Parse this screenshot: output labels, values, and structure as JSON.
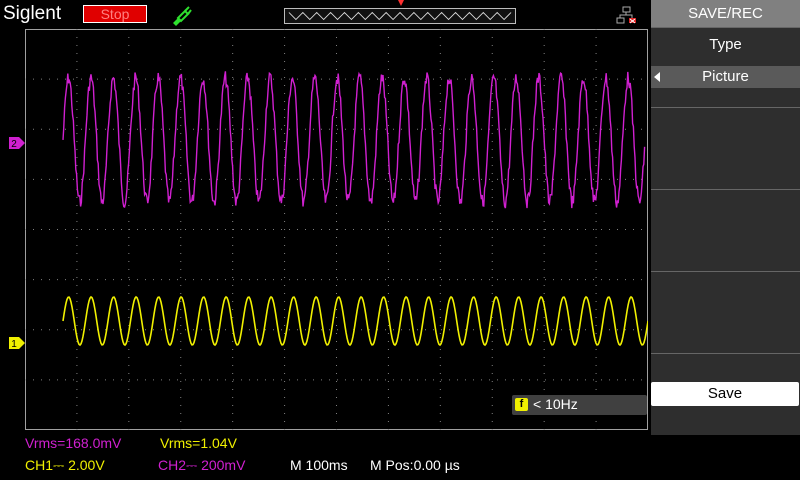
{
  "top": {
    "brand": "Siglent",
    "run_state": "Stop",
    "run_state_color": "#e00000"
  },
  "measurements": {
    "ch2_vrms": "Vrms=168.0mV",
    "ch1_vrms": "Vrms=1.04V"
  },
  "status": {
    "ch1_scale": "CH1⎓ 2.00V",
    "ch2_scale": "CH2⎓ 200mV",
    "timebase": "M 100ms",
    "mpos": "M Pos:0.00 µs"
  },
  "freq": {
    "badge": "f",
    "text": "< 10Hz"
  },
  "markers": {
    "ch1": "1",
    "ch2": "2"
  },
  "menu": {
    "title": "SAVE/REC",
    "type_label": "Type",
    "type_value": "Picture",
    "save_button": "Save"
  },
  "colors": {
    "ch1": "#f0f000",
    "ch2": "#d020d0",
    "grid": "#808080",
    "menu_bg": "#2e2e2e"
  },
  "waveforms": {
    "ch2_cycles": 26,
    "ch1_cycles": 26
  }
}
